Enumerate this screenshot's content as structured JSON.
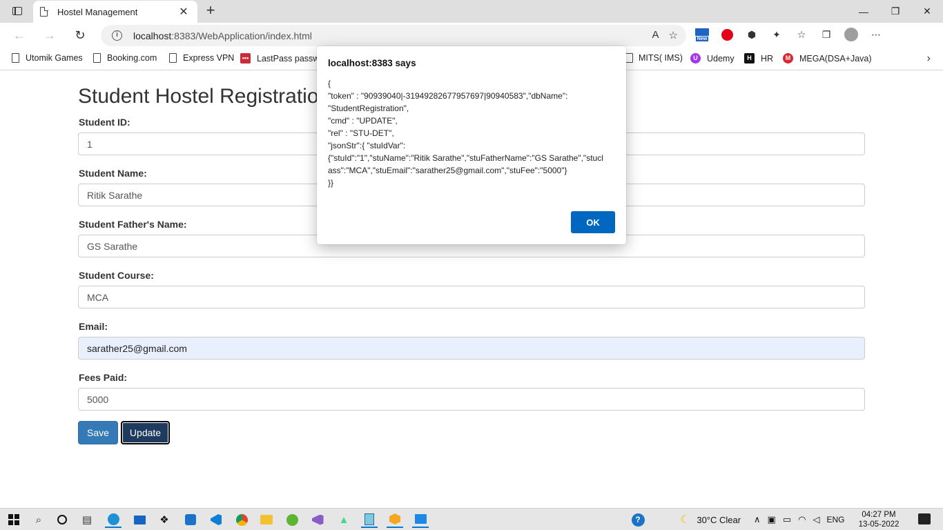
{
  "browser": {
    "tab_title": "Hostel Management",
    "tab_close": "✕",
    "new_tab": "+",
    "url_host": "localhost",
    "url_rest": ":8383/WebApplication/index.html",
    "bookmarks": [
      {
        "label": "Utomik Games"
      },
      {
        "label": "Booking.com"
      },
      {
        "label": "Express VPN"
      },
      {
        "label": "LastPass passwo"
      },
      {
        "label": "MITS( IMS)"
      },
      {
        "label": "Udemy"
      },
      {
        "label": "HR"
      },
      {
        "label": "MEGA(DSA+Java)"
      }
    ],
    "ext_new_badge": "New"
  },
  "form": {
    "title": "Student Hostel Registratio",
    "fields": [
      {
        "label": "Student ID:",
        "value": "1"
      },
      {
        "label": "Student Name:",
        "value": "Ritik Sarathe"
      },
      {
        "label": "Student Father's Name:",
        "value": "GS Sarathe"
      },
      {
        "label": "Student Course:",
        "value": "MCA"
      },
      {
        "label": "Email:",
        "value": "sarather25@gmail.com"
      },
      {
        "label": "Fees Paid:",
        "value": "5000"
      }
    ],
    "save_label": "Save",
    "update_label": "Update"
  },
  "dialog": {
    "title": "localhost:8383 says",
    "message": "{\n\"token\" : \"90939040|-31949282677957697|90940583\",\"dbName\":\n\"StudentRegistration\",\n\"cmd\" : \"UPDATE\",\n\"rel\" : \"STU-DET\",\n\"jsonStr\":{ \"stuIdVar\":\n{\"stuId\":\"1\",\"stuName\":\"Ritik Sarathe\",\"stuFatherName\":\"GS Sarathe\",\"stuclass\":\"MCA\",\"stuEmail\":\"sarather25@gmail.com\",\"stuFee\":\"5000\"}\n}}",
    "ok_label": "OK"
  },
  "taskbar": {
    "weather": "30°C  Clear",
    "lang": "ENG",
    "time": "04:27 PM",
    "date": "13-05-2022"
  }
}
